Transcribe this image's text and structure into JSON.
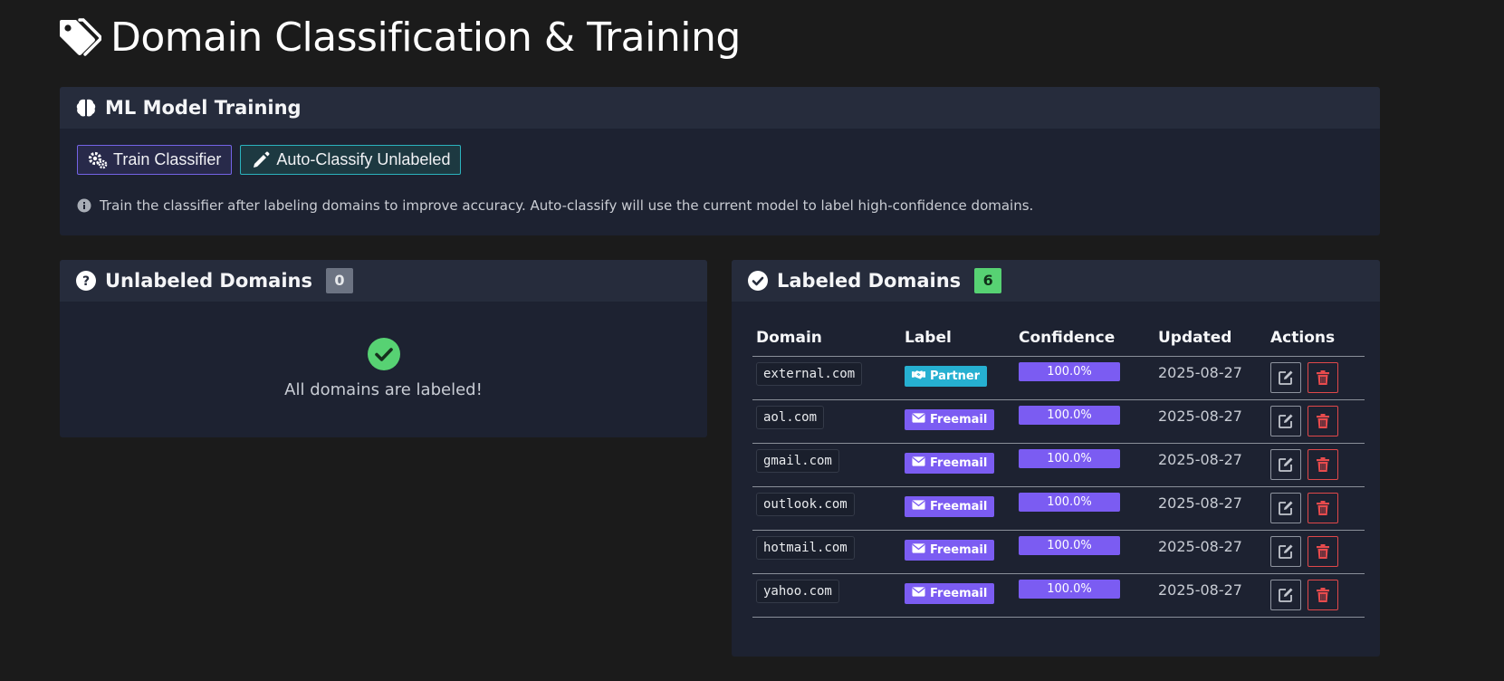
{
  "page": {
    "title": "Domain Classification & Training",
    "title_icon": "tags-icon"
  },
  "ml_training": {
    "header": "ML Model Training",
    "header_icon": "brain-icon",
    "train_button": "Train Classifier",
    "train_icon": "gears-icon",
    "autoclassify_button": "Auto-Classify Unlabeled",
    "autoclassify_icon": "pencil-icon",
    "hint": "Train the classifier after labeling domains to improve accuracy. Auto-classify will use the current model to label high-confidence domains.",
    "hint_icon": "info-icon"
  },
  "unlabeled": {
    "header": "Unlabeled Domains",
    "header_icon": "question-circle-icon",
    "count": "0",
    "empty_message": "All domains are labeled!",
    "empty_icon": "check-circle-icon"
  },
  "labeled": {
    "header": "Labeled Domains",
    "header_icon": "check-circle-icon",
    "count": "6",
    "columns": [
      "Domain",
      "Label",
      "Confidence",
      "Updated",
      "Actions"
    ],
    "rows": [
      {
        "domain": "external.com",
        "label": "Partner",
        "label_icon": "handshake-icon",
        "label_color": "#26b0d1",
        "confidence": 1.0,
        "confidence_text": "100.0%",
        "updated": "2025-08-27"
      },
      {
        "domain": "aol.com",
        "label": "Freemail",
        "label_icon": "envelope-icon",
        "label_color": "#7b5cf2",
        "confidence": 1.0,
        "confidence_text": "100.0%",
        "updated": "2025-08-27"
      },
      {
        "domain": "gmail.com",
        "label": "Freemail",
        "label_icon": "envelope-icon",
        "label_color": "#7b5cf2",
        "confidence": 1.0,
        "confidence_text": "100.0%",
        "updated": "2025-08-27"
      },
      {
        "domain": "outlook.com",
        "label": "Freemail",
        "label_icon": "envelope-icon",
        "label_color": "#7b5cf2",
        "confidence": 1.0,
        "confidence_text": "100.0%",
        "updated": "2025-08-27"
      },
      {
        "domain": "hotmail.com",
        "label": "Freemail",
        "label_icon": "envelope-icon",
        "label_color": "#7b5cf2",
        "confidence": 1.0,
        "confidence_text": "100.0%",
        "updated": "2025-08-27"
      },
      {
        "domain": "yahoo.com",
        "label": "Freemail",
        "label_icon": "envelope-icon",
        "label_color": "#7b5cf2",
        "confidence": 1.0,
        "confidence_text": "100.0%",
        "updated": "2025-08-27"
      }
    ],
    "edit_icon": "edit-icon",
    "delete_icon": "trash-icon"
  },
  "colors": {
    "background": "#1b1b1b",
    "card": "#1d2231",
    "card_header": "#262c3c",
    "accent_purple": "#7b5cf2",
    "accent_teal": "#2bb3be",
    "success_green": "#57d273",
    "danger_red": "#e0484a"
  }
}
